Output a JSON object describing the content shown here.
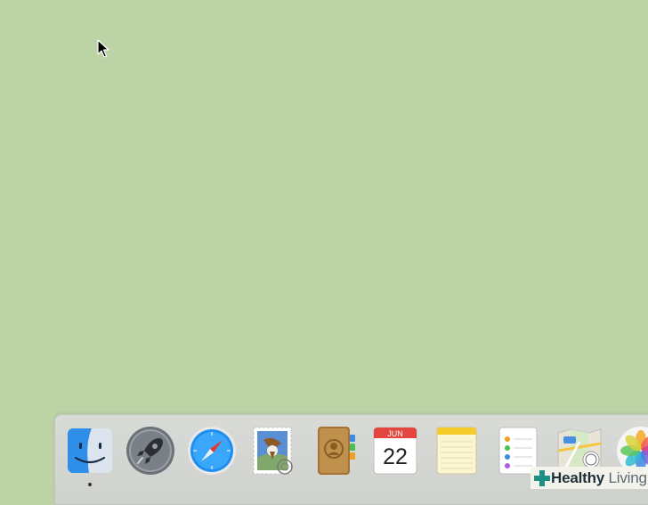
{
  "desktop": {
    "background_color": "#bcd3a6"
  },
  "dock": {
    "items": [
      {
        "name": "Finder",
        "icon": "finder-icon",
        "running": true
      },
      {
        "name": "Launchpad",
        "icon": "launchpad-rocket-icon",
        "running": false
      },
      {
        "name": "Safari",
        "icon": "safari-compass-icon",
        "running": false
      },
      {
        "name": "Mail",
        "icon": "mail-stamp-icon",
        "running": false
      },
      {
        "name": "Contacts",
        "icon": "contacts-book-icon",
        "running": false
      },
      {
        "name": "Calendar",
        "icon": "calendar-icon",
        "running": false,
        "month": "JUN",
        "day": "22"
      },
      {
        "name": "Notes",
        "icon": "notes-pad-icon",
        "running": false
      },
      {
        "name": "Reminders",
        "icon": "reminders-list-icon",
        "running": false
      },
      {
        "name": "Maps",
        "icon": "maps-icon",
        "running": false
      },
      {
        "name": "Photos",
        "icon": "photos-flower-icon",
        "running": false
      }
    ]
  },
  "watermark": {
    "brand_bold": "Healthy",
    "brand_light": "Living",
    "logo_icon": "plus-cross-icon",
    "logo_color": "#1f8f86"
  }
}
